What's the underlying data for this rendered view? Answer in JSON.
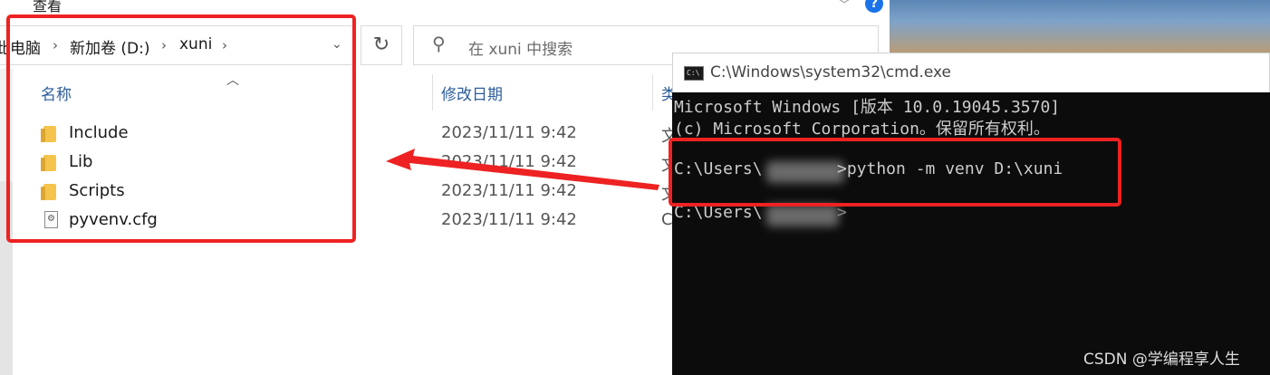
{
  "explorer": {
    "ribbon_label": "查看",
    "address": {
      "crumb_1": "此电脑",
      "crumb_2": "新加卷 (D:)",
      "crumb_3": "xuni"
    },
    "search_placeholder": "在 xuni 中搜索",
    "columns": {
      "name": "名称",
      "date": "修改日期",
      "type": "类"
    },
    "rows": [
      {
        "name": "Include",
        "date": "2023/11/11 9:42",
        "type": "文",
        "icon": "folder-icon"
      },
      {
        "name": "Lib",
        "date": "2023/11/11 9:42",
        "type": "文",
        "icon": "folder-icon"
      },
      {
        "name": "Scripts",
        "date": "2023/11/11 9:42",
        "type": "文",
        "icon": "folder-icon"
      },
      {
        "name": "pyvenv.cfg",
        "date": "2023/11/11 9:42",
        "type": "C",
        "icon": "config-file-icon"
      }
    ]
  },
  "cmd": {
    "title": "C:\\Windows\\system32\\cmd.exe",
    "line_1": "Microsoft Windows [版本 10.0.19045.3570]",
    "line_2": "(c) Microsoft Corporation。保留所有权利。",
    "line_3_prefix": "C:\\Users\\",
    "line_3_command": ">python -m venv D:\\xuni",
    "line_4_prefix": "C:\\Users\\",
    "line_4_suffix": ">"
  },
  "watermark": "CSDN @学编程享人生",
  "colors": {
    "highlight": "#ee2222",
    "console_bg": "#0c0c0c",
    "console_text": "#cccccc",
    "folder": "#f4c44d"
  }
}
